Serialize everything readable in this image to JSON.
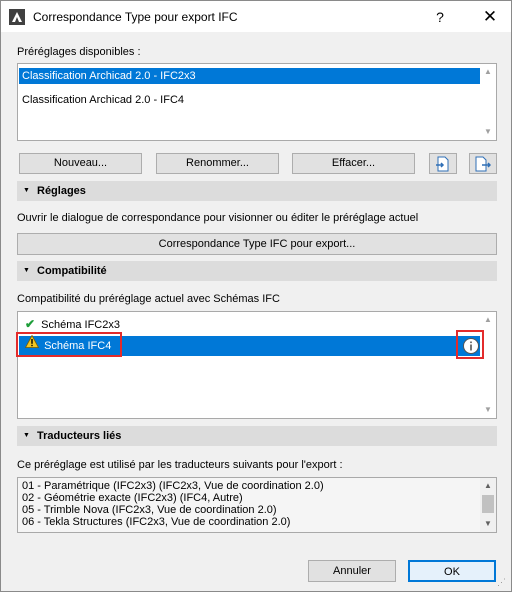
{
  "window": {
    "title": "Correspondance Type pour export IFC",
    "help": "?",
    "close": "✕"
  },
  "presets": {
    "label": "Préréglages disponibles :",
    "items": [
      {
        "label": "Classification Archicad 2.0 - IFC2x3",
        "selected": true
      },
      {
        "label": "Classification Archicad 2.0 - IFC4",
        "selected": false
      }
    ]
  },
  "buttons": {
    "new": "Nouveau...",
    "rename": "Renommer...",
    "delete": "Effacer..."
  },
  "settings": {
    "title": "Réglages",
    "description": "Ouvrir le dialogue de correspondance pour visionner ou éditer le préréglage actuel",
    "mapping_button": "Correspondance Type IFC pour export..."
  },
  "compatibility": {
    "title": "Compatibilité",
    "description": "Compatibilité du préréglage actuel avec Schémas IFC",
    "items": [
      {
        "label": "Schéma IFC2x3",
        "icon": "checkmark-icon"
      },
      {
        "label": "Schéma IFC4",
        "icon": "warning-icon"
      }
    ]
  },
  "translators": {
    "title": "Traducteurs liés",
    "description": "Ce préréglage est utilisé par les traducteurs suivants pour l'export :",
    "items": [
      "01 - Paramétrique (IFC2x3) (IFC2x3, Vue de coordination 2.0)",
      "02 - Géométrie exacte (IFC2x3) (IFC4, Autre)",
      "05 - Trimble Nova (IFC2x3, Vue de coordination 2.0)",
      "06 - Tekla Structures (IFC2x3, Vue de coordination 2.0)"
    ]
  },
  "footer": {
    "cancel": "Annuler",
    "ok": "OK"
  },
  "colors": {
    "selection": "#0078d7",
    "highlight_box": "#e32b2b",
    "section_bg": "#dcdcdc"
  }
}
